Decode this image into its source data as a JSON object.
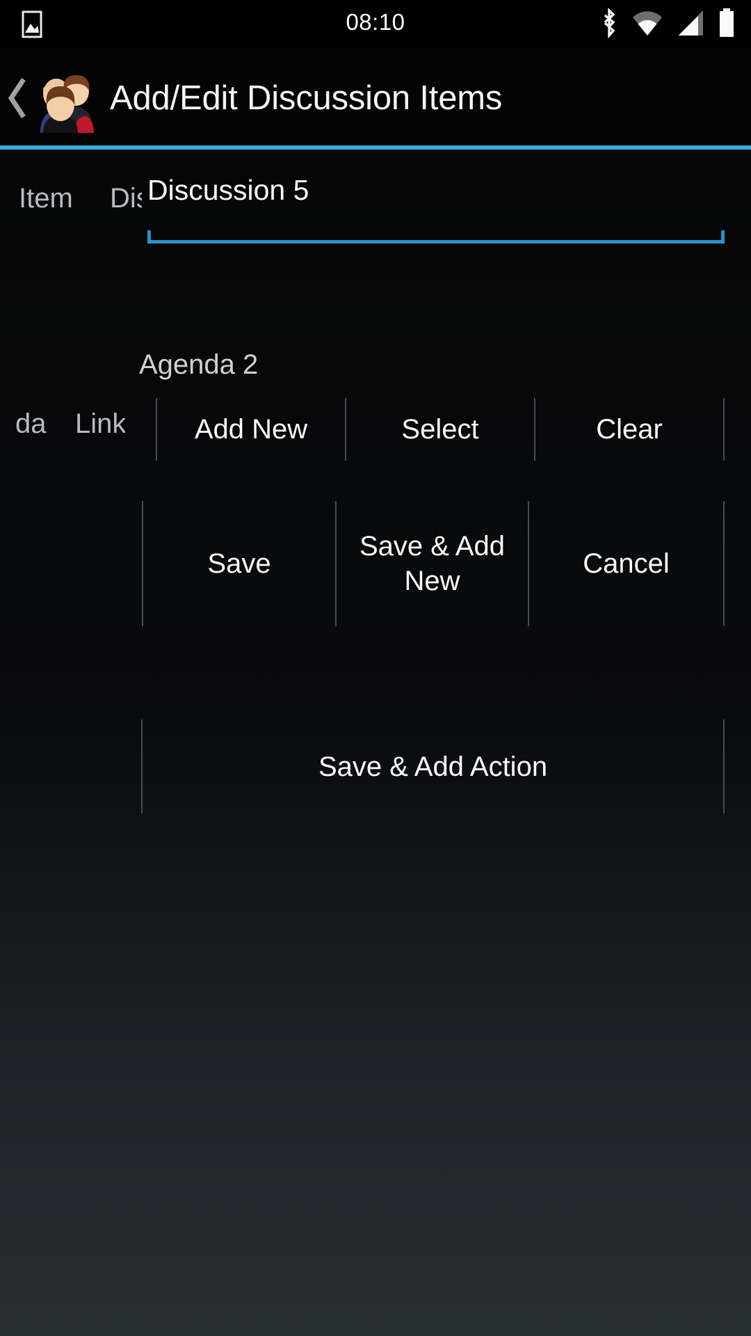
{
  "status_bar": {
    "time": "08:10",
    "left_icon": "image-icon",
    "right_icons": [
      "bluetooth-icon",
      "wifi-icon",
      "cellular-signal-icon",
      "battery-icon"
    ]
  },
  "app_bar": {
    "back_label": "❮",
    "app_icon": "group-people-icon",
    "title": "Add/Edit Discussion Items"
  },
  "theme": {
    "accent": "#35a8e0",
    "field_underline": "#2a93c6",
    "divider": "#494d52",
    "background": "#050505",
    "text": "#fbfbfb",
    "muted_text": "#b7bcc0"
  },
  "form": {
    "discussion_row": {
      "clipped_labels": [
        "Item",
        "Dis"
      ],
      "field": {
        "value": "Discussion 5",
        "placeholder": "Discussion",
        "focused": true
      }
    },
    "agenda_row": {
      "clipped_labels": [
        "da",
        "Link"
      ],
      "label": "Agenda 2",
      "buttons": [
        "Add New",
        "Select",
        "Clear"
      ]
    },
    "action_row": {
      "buttons": [
        "Save",
        "Save & Add New",
        "Cancel"
      ]
    },
    "extra_row": {
      "buttons": [
        "Save & Add Action"
      ]
    }
  }
}
